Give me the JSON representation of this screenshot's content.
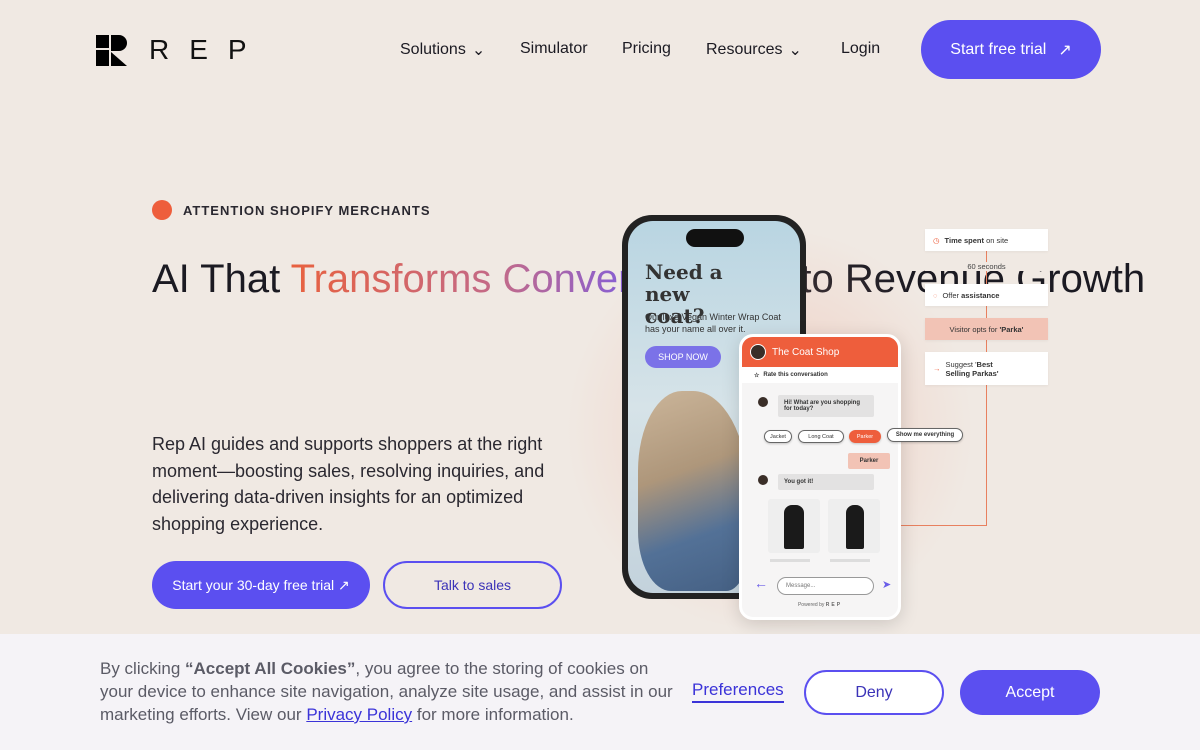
{
  "nav": {
    "brand": "REP",
    "items": [
      {
        "label": "Solutions",
        "dropdown": true
      },
      {
        "label": "Simulator"
      },
      {
        "label": "Pricing"
      },
      {
        "label": "Resources",
        "dropdown": true
      },
      {
        "label": "Login"
      }
    ],
    "cta": "Start free trial"
  },
  "hero": {
    "eyebrow": "ATTENTION SHOPIFY MERCHANTS",
    "title_1": "AI That ",
    "title_2": "Transforms Conversations",
    "title_3": " into Revenue Growth",
    "description": "Rep AI guides and supports shoppers at the right moment—boosting sales, resolving inquiries, and delivering data-driven insights for an optimized shopping experience.",
    "primary_cta": "Start your 30-day free trial ↗",
    "secondary_cta": "Talk to sales"
  },
  "phone": {
    "title": "Need a new coat?",
    "subtitle": "Our luxe Vegan Winter Wrap Coat has your name all over it.",
    "button": "SHOP NOW"
  },
  "chat": {
    "shop_name": "The Coat Shop",
    "rate": "Rate this conversation",
    "bot_msg_1": "Hi! What are you shopping for today?",
    "chips": [
      "Jacket",
      "Long Coat",
      "Parker",
      "Show me everything"
    ],
    "user_msg": "Parker",
    "bot_msg_2": "You got it!",
    "input_placeholder": "Message...",
    "powered_by": "Powered by",
    "powered_brand": "REP"
  },
  "flow": {
    "step1_a": "Time spent",
    "step1_b": " on site",
    "delay": "60 seconds",
    "step2_a": "Offer ",
    "step2_b": "assistance",
    "step3_a": "Visitor opts for ",
    "step3_b": "'Parka'",
    "step4_a": "Suggest '",
    "step4_b": "Best Selling Parkas'"
  },
  "cookie": {
    "text_1": "By clicking ",
    "text_bold": "“Accept All Cookies”",
    "text_2": ", you agree to the storing of cookies on your device to enhance site navigation, analyze site usage, and assist in our marketing efforts. View our ",
    "privacy_link": "Privacy Policy",
    "text_3": " for more information.",
    "preferences": "Preferences",
    "deny": "Deny",
    "accept": "Accept"
  },
  "colors": {
    "accent": "#5b4ff0",
    "orange": "#ee5e3c",
    "background": "#f0e9e3"
  }
}
